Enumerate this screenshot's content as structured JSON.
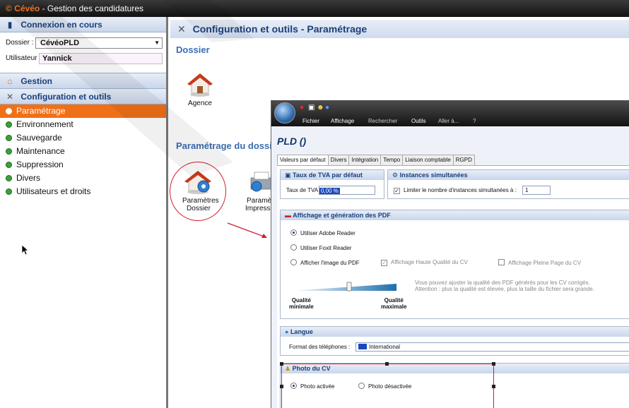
{
  "app": {
    "brand": "Cévéo",
    "separator": "-",
    "title": "Gestion des candidatures"
  },
  "sidebar": {
    "connexion_header": "Connexion en cours",
    "dossier_label": "Dossier :",
    "dossier_value": "CévéoPLD",
    "user_label": "Utilisateur :",
    "user_value": "Yannick",
    "gestion_header": "Gestion",
    "config_header": "Configuration et outils",
    "items": [
      {
        "label": "Paramétrage"
      },
      {
        "label": "Environnement"
      },
      {
        "label": "Sauvegarde"
      },
      {
        "label": "Maintenance"
      },
      {
        "label": "Suppression"
      },
      {
        "label": "Divers"
      },
      {
        "label": "Utilisateurs et droits"
      }
    ]
  },
  "main": {
    "header_title": "Configuration et outils - Paramétrage",
    "section_dossier": "Dossier",
    "agence_label": "Agence",
    "section_param": "Paramétrage du dossie",
    "param_dossier_line1": "Paramètres",
    "param_dossier_line2": "Dossier",
    "param_impr_line1": "Paramèt",
    "param_impr_line2": "Impressi"
  },
  "dialog": {
    "menu": [
      "Fichier",
      "Affichage",
      "Rechercher",
      "Outils",
      "Aller à...",
      "?"
    ],
    "title": "PLD ()",
    "tabs": [
      "Valeurs par défaut",
      "Divers",
      "Intégration",
      "Tempo",
      "Liaison comptable",
      "RGPD"
    ],
    "tva": {
      "header": "Taux de TVA par défaut",
      "label": "Taux de TVA :",
      "value": "0,00 %"
    },
    "instances": {
      "header": "Instances simultanées",
      "checkbox_label": "Limiter le nombre d'instances simultanées à :",
      "value": "1"
    },
    "pdf": {
      "header": "Affichage et génération des PDF",
      "opt_adobe": "Utiliser Adobe Reader",
      "opt_foxit": "Utiliser Foxit Reader",
      "opt_image": "Afficher l'image du PDF",
      "chk_hq": "Affichage Haute Qualité du CV",
      "chk_full": "Affichage Pleine Page du CV",
      "info_line1": "Vous pouvez ajuster la qualité des PDF générés pour les CV corrigés.",
      "info_line2": "Attention : plus la qualité est élevée, plus la taille du fichier sera grande.",
      "q_min_1": "Qualité",
      "q_min_2": "minimale",
      "q_max_1": "Qualité",
      "q_max_2": "maximale"
    },
    "langue": {
      "header": "Langue",
      "label": "Format des téléphones :",
      "value": "International"
    },
    "photo": {
      "header": "Photo du CV",
      "on": "Photo activée",
      "off": "Photo désactivée"
    }
  },
  "colors": {
    "accent": "#f07018",
    "header_blue": "#1a3f7a",
    "highlight_red": "#d0202a"
  }
}
